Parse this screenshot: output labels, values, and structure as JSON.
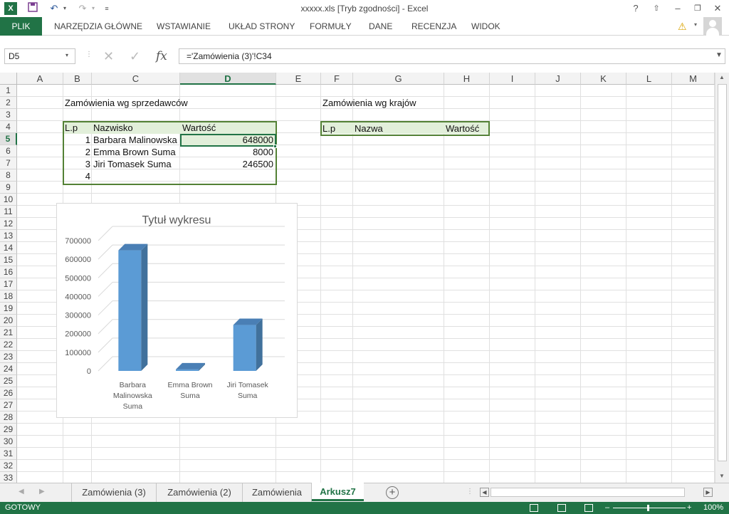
{
  "title": "xxxxx.xls  [Tryb zgodności] - Excel",
  "ribbon": {
    "file_tab": "PLIK",
    "tabs": [
      "NARZĘDZIA GŁÓWNE",
      "WSTAWIANIE",
      "UKŁAD STRONY",
      "FORMUŁY",
      "DANE",
      "RECENZJA",
      "WIDOK"
    ]
  },
  "formula_bar": {
    "name_box": "D5",
    "formula": "='Zamówienia (3)'!C34",
    "fx": "fx"
  },
  "columns": [
    "A",
    "B",
    "C",
    "D",
    "E",
    "F",
    "G",
    "H",
    "I",
    "J",
    "K",
    "L",
    "M"
  ],
  "rows": [
    "1",
    "2",
    "3",
    "4",
    "5",
    "6",
    "7",
    "8",
    "9",
    "10",
    "11",
    "12",
    "13",
    "14",
    "15",
    "16",
    "17",
    "18",
    "19",
    "20",
    "21",
    "22",
    "23",
    "24",
    "25",
    "26",
    "27",
    "28",
    "29",
    "30",
    "31",
    "32",
    "33"
  ],
  "sheet": {
    "title_left": "Zamówienia wg sprzedawców",
    "title_right": "Zamówienia wg krajów",
    "left_table": {
      "headers": [
        "L.p",
        "Nazwisko",
        "Wartość"
      ],
      "rows": [
        {
          "lp": "1",
          "name": "Barbara Malinowska",
          "value": "648000"
        },
        {
          "lp": "2",
          "name": "Emma Brown Suma",
          "value": "8000"
        },
        {
          "lp": "3",
          "name": "Jiri Tomasek Suma",
          "value": "246500"
        },
        {
          "lp": "4",
          "name": "",
          "value": ""
        }
      ]
    },
    "right_table": {
      "headers": [
        "L.p",
        "Nazwa",
        "Wartość"
      ]
    }
  },
  "chart_data": {
    "type": "bar",
    "title": "Tytuł wykresu",
    "categories": [
      "Barbara Malinowska Suma",
      "Emma Brown Suma",
      "Jiri Tomasek Suma"
    ],
    "category_lines": [
      [
        "Barbara",
        "Malinowska",
        "Suma"
      ],
      [
        "Emma Brown",
        "Suma"
      ],
      [
        "Jiri Tomasek",
        "Suma"
      ]
    ],
    "values": [
      648000,
      8000,
      246500
    ],
    "ylim": [
      0,
      700000
    ],
    "yticks": [
      "700000",
      "600000",
      "500000",
      "400000",
      "300000",
      "200000",
      "100000",
      "0"
    ],
    "bar_color": "#5b9bd5",
    "grid": true,
    "legend": "none"
  },
  "sheet_tabs": [
    "Zamówienia (3)",
    "Zamówienia (2)",
    "Zamówienia",
    "Arkusz7"
  ],
  "active_sheet": "Arkusz7",
  "status": {
    "ready": "GOTOWY",
    "zoom": "100%"
  },
  "colors": {
    "excel_green": "#217346",
    "table_border": "#538135",
    "header_fill": "#e2efda"
  }
}
